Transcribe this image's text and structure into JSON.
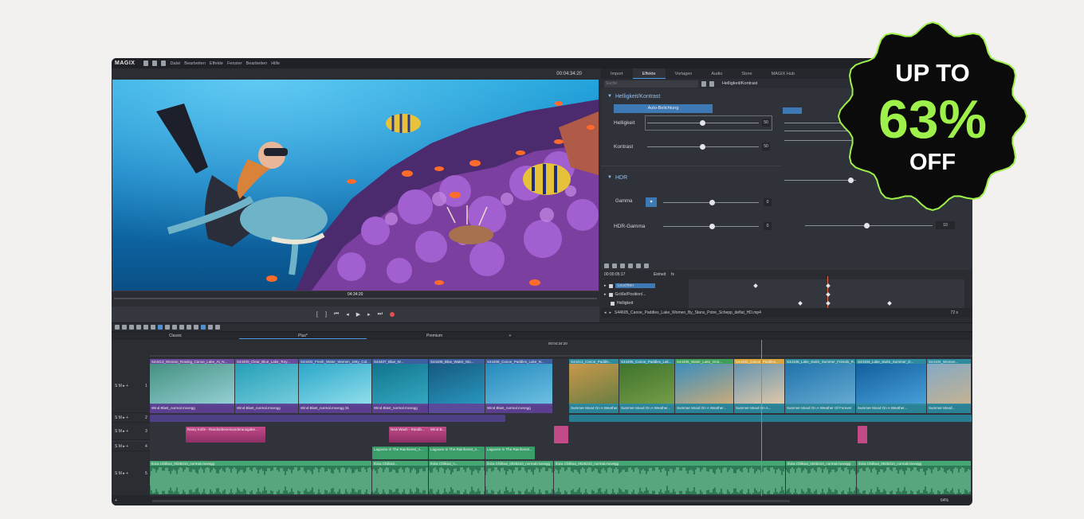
{
  "app": {
    "logo": "MAGIX",
    "menu": [
      "Datei",
      "Bearbeiten",
      "Effekte",
      "Fenster",
      "Bearbeiten",
      "Hilfe"
    ],
    "timecode": "00:04:34:20"
  },
  "preview": {
    "scrub_timecode": "04:34:20",
    "position": 0.51
  },
  "panel": {
    "tabs": [
      "Import",
      "Effekte",
      "Vorlagen",
      "Audio",
      "Store",
      "MAGIX Hub"
    ],
    "active_tab": "Effekte",
    "search_placeholder": "Suche",
    "breadcrumb": "Helligkeit/Kontrast",
    "section1_title": "Helligkeit/Kontrast",
    "auto_button": "Auto-Belichtung",
    "helligkeit_label": "Helligkeit",
    "helligkeit_value": "50",
    "kontrast_label": "Kontrast",
    "kontrast_value": "50",
    "section2_title": "HDR",
    "gamma_label": "Gamma",
    "gamma_value": "0",
    "hdr_gamma_label": "HDR-Gamma",
    "hdr_gamma_value": "0",
    "extra_value": "10"
  },
  "keyframes": {
    "time": "00:00:05:17",
    "einheit_label": "Einheit",
    "einheit_value": "fx",
    "rows": [
      "Leuchten",
      "Größe/Position/...",
      "Helligkeit"
    ],
    "file_path": "S44605_Canoe_Paddles_Lake_Women_By_Stans_Potre_Schepp_deflat_HD.mp4",
    "zoom": "72 s"
  },
  "arrangers": {
    "tab1": "Classic",
    "tab2": "Plus*",
    "tab3": "Premium"
  },
  "timeline": {
    "playhead_timecode": "00:04:34:20",
    "video_clips": [
      "S44413_Woman_Rowing_Canoe_Lake_At_N...",
      "S44400_Clear_Blue_Lake_Tory...",
      "S44402_Fresh_Water_Women_Jetty_Cal...",
      "S44407_Blue_W...",
      "S44408_Blue_Water_Sto...",
      "S44408_Canoe_Paddles_Lake_N...",
      "S44413_Canoe_Paddle...",
      "S44405_Canoe_Paddles_Lak...",
      "S44406_Water_Lake_Grut...",
      "S44403_Canoe_Paddles...",
      "S44106_Lake_Swim_Summer_Friends_R...",
      "S44104_Lake_Swim_Summer_D...",
      "S44104_Woman..."
    ],
    "sub_clips": [
      "Wind Blast_normal.mxvegg",
      "Wind Blast_normal.mxvegg",
      "Wind Blast_normal.mxvegg 31",
      "Wind Blast_normal.mxvegg",
      "Wind Blast_normal.mxvegg",
      "Summer Mood On A Weather...",
      "Summer Mood On A Weather...",
      "Summer Mood On A Weather...",
      "Summer Mood On A...",
      "Summer Mood On A Weather Of Forever",
      "Summer Mood On A Weather...",
      "Summer Mood..."
    ],
    "fx_clips": [
      "Rainy Knife - Randnebeneinanderausgabe...",
      "New Wash - Randb...",
      "Wind B..."
    ],
    "lagoon_clips": [
      "Lagoons In The Rainforest_n...",
      "Lagoons In The Rainforest_n...",
      "Lagoons In The Rainforest..."
    ],
    "audio_clips": [
      "Ibiza Chillout_0026210_normal.mxvegg",
      "Ibiza Chillout...",
      "Ibiza Chillout_n...",
      "Ibiza Chillout_0026210_normal.mxvegg",
      "Ibiza Chillout_0026210_normal.mxvegg",
      "Ibiza Chillout_0026210_normal.mxvegg",
      "Ibiza Chillout_0026210_normal.mxvegg"
    ],
    "track_numbers": [
      "1",
      "2",
      "3",
      "4",
      "5"
    ],
    "zoom_percent": "64%"
  },
  "badge": {
    "line1": "UP TO",
    "line2": "63%",
    "line3": "OFF",
    "accent": "#9ef04a"
  }
}
